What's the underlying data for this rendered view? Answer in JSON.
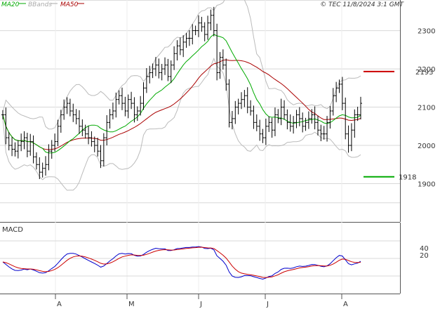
{
  "header": {
    "legend": [
      {
        "label": "MA20",
        "color": "#00aa00"
      },
      {
        "label": "BBands",
        "color": "#aaaaaa"
      },
      {
        "label": "MA50",
        "color": "#aa0000"
      }
    ],
    "copyright": "© TEC 11/8/2024 3:1 GMT"
  },
  "chart_data": [
    {
      "type": "ohlc",
      "title": "",
      "ylim": [
        1800,
        2380
      ],
      "y_ticks": [
        {
          "value": 2300,
          "label": "2300"
        },
        {
          "value": 2200,
          "label": "2200"
        },
        {
          "value": 2100,
          "label": "2100"
        },
        {
          "value": 2000,
          "label": "2000"
        },
        {
          "value": 1900,
          "label": "1900"
        }
      ],
      "x_ticks": [
        "A",
        "M",
        "J",
        "J",
        "A"
      ],
      "close": [
        2080,
        2020,
        2000,
        1990,
        1985,
        2000,
        2010,
        2020,
        1985,
        2010,
        1970,
        1950,
        1930,
        1940,
        1950,
        1985,
        2000,
        2010,
        2050,
        2080,
        2100,
        2110,
        2090,
        2080,
        2070,
        2050,
        2040,
        2030,
        2020,
        2010,
        2000,
        1985,
        1960,
        2020,
        2060,
        2080,
        2090,
        2120,
        2130,
        2110,
        2090,
        2120,
        2110,
        2080,
        2090,
        2110,
        2150,
        2180,
        2190,
        2200,
        2210,
        2190,
        2200,
        2210,
        2180,
        2210,
        2240,
        2260,
        2250,
        2270,
        2280,
        2280,
        2300,
        2300,
        2320,
        2310,
        2290,
        2320,
        2340,
        2300,
        2190,
        2230,
        2210,
        2160,
        2060,
        2070,
        2100,
        2110,
        2120,
        2130,
        2100,
        2090,
        2060,
        2050,
        2030,
        2020,
        2050,
        2060,
        2040,
        2080,
        2070,
        2100,
        2080,
        2060,
        2050,
        2060,
        2080,
        2070,
        2050,
        2060,
        2070,
        2080,
        2060,
        2040,
        2030,
        2030,
        2060,
        2090,
        2130,
        2150,
        2160,
        2110,
        2030,
        2000,
        2040,
        2080,
        2080,
        2110
      ],
      "levels": [
        {
          "value": 2193,
          "label": "2193",
          "color": "#cc0000"
        },
        {
          "value": 1918,
          "label": "1918",
          "color": "#00aa00"
        }
      ]
    },
    {
      "type": "line",
      "title": "MACD",
      "ylim": [
        -90,
        110
      ],
      "y_ticks": [
        {
          "value": 40,
          "label": "40"
        },
        {
          "value": 20,
          "label": "20"
        }
      ],
      "series": [
        {
          "name": "",
          "color": "#0000cc"
        },
        {
          "name": "",
          "color": "#cc0000"
        }
      ]
    }
  ]
}
